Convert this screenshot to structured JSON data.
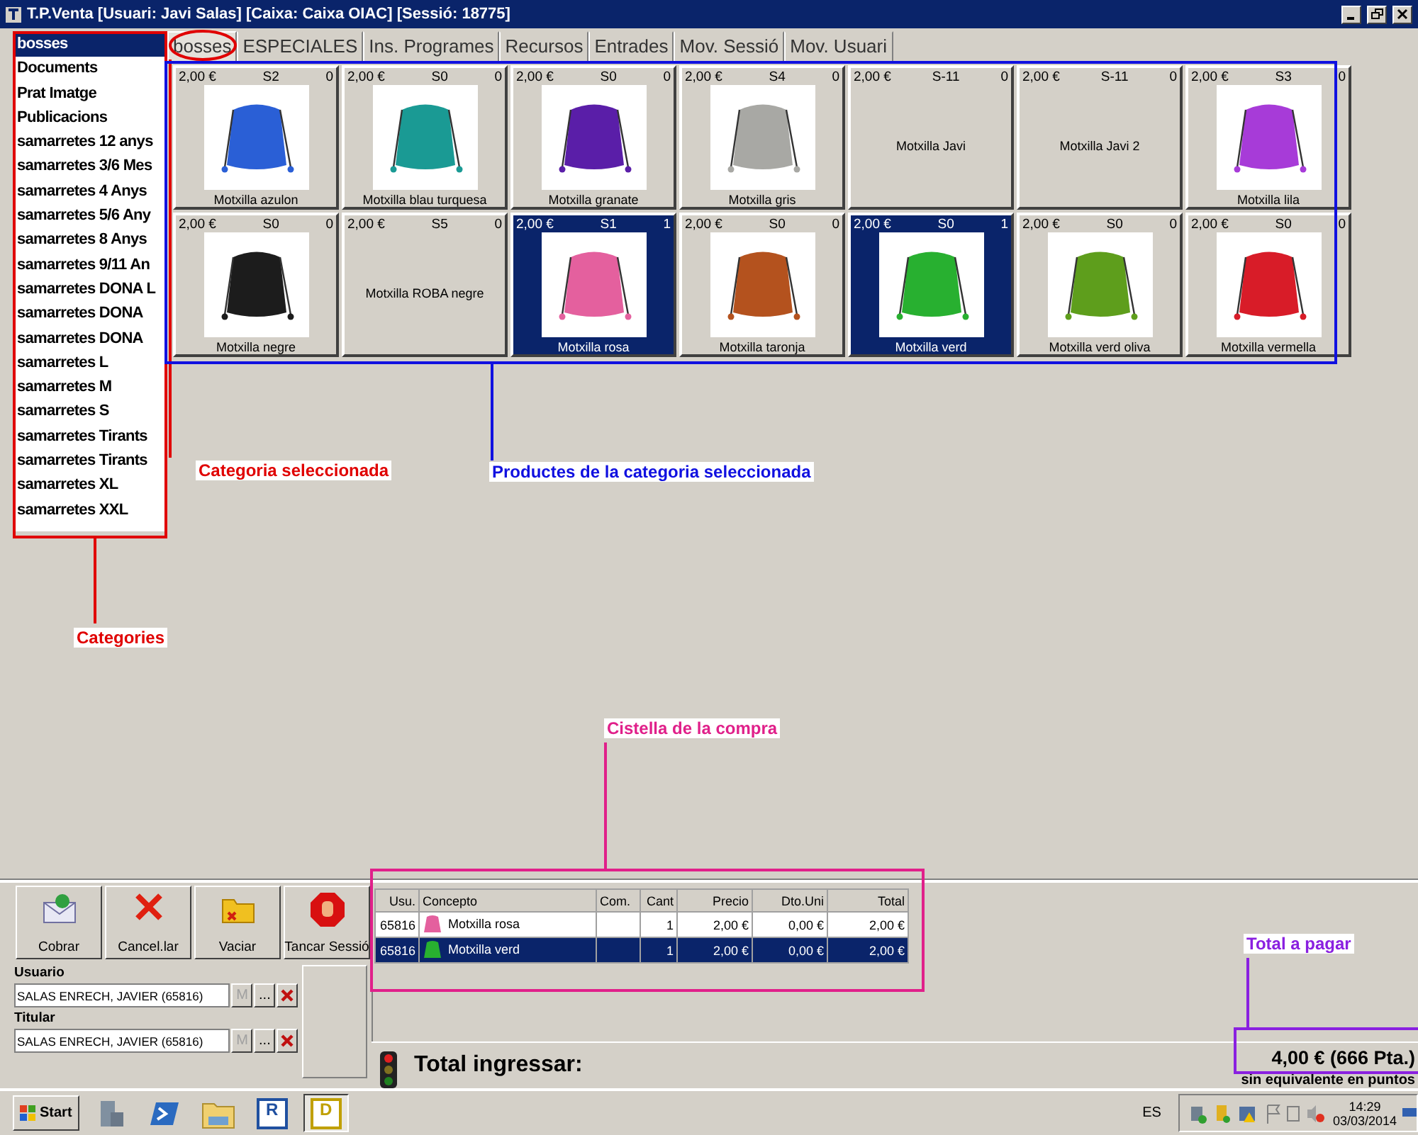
{
  "window": {
    "title": "T.P.Venta [Usuari: Javi Salas] [Caixa: Caixa OIAC] [Sessió: 18775]"
  },
  "categories": [
    {
      "label": "bosses",
      "selected": true
    },
    {
      "label": "Documents",
      "selected": false
    },
    {
      "label": "Prat Imatge",
      "selected": false
    },
    {
      "label": "Publicacions",
      "selected": false
    },
    {
      "label": "samarretes 12 anys",
      "selected": false
    },
    {
      "label": "samarretes 3/6 Mes",
      "selected": false
    },
    {
      "label": "samarretes 4 Anys",
      "selected": false
    },
    {
      "label": "samarretes 5/6 Any",
      "selected": false
    },
    {
      "label": "samarretes 8 Anys",
      "selected": false
    },
    {
      "label": "samarretes 9/11 An",
      "selected": false
    },
    {
      "label": "samarretes DONA L",
      "selected": false
    },
    {
      "label": "samarretes DONA",
      "selected": false
    },
    {
      "label": "samarretes DONA",
      "selected": false
    },
    {
      "label": "samarretes L",
      "selected": false
    },
    {
      "label": "samarretes M",
      "selected": false
    },
    {
      "label": "samarretes S",
      "selected": false
    },
    {
      "label": "samarretes Tirants",
      "selected": false
    },
    {
      "label": "samarretes Tirants",
      "selected": false
    },
    {
      "label": "samarretes XL",
      "selected": false
    },
    {
      "label": "samarretes XXL",
      "selected": false
    }
  ],
  "tabs": [
    {
      "label": "bosses",
      "selected": true
    },
    {
      "label": "ESPECIALES",
      "selected": false
    },
    {
      "label": "Ins. Programes",
      "selected": false
    },
    {
      "label": "Recursos",
      "selected": false
    },
    {
      "label": "Entrades",
      "selected": false
    },
    {
      "label": "Mov. Sessió",
      "selected": false
    },
    {
      "label": "Mov. Usuari",
      "selected": false
    }
  ],
  "products": [
    {
      "price": "2,00 €",
      "code": "S2",
      "count": "0",
      "name": "Motxilla azulon",
      "kind": "photo",
      "color": "#2a5fd6",
      "selected": false
    },
    {
      "price": "2,00 €",
      "code": "S0",
      "count": "0",
      "name": "Motxilla blau turquesa",
      "kind": "photo",
      "color": "#1a9a94",
      "selected": false
    },
    {
      "price": "2,00 €",
      "code": "S0",
      "count": "0",
      "name": "Motxilla granate",
      "kind": "photo",
      "color": "#5a1ea8",
      "selected": false
    },
    {
      "price": "2,00 €",
      "code": "S4",
      "count": "0",
      "name": "Motxilla gris",
      "kind": "photo",
      "color": "#a8a8a4",
      "selected": false
    },
    {
      "price": "2,00 €",
      "code": "S-11",
      "count": "0",
      "name": "Motxilla Javi",
      "kind": "text",
      "selected": false
    },
    {
      "price": "2,00 €",
      "code": "S-11",
      "count": "0",
      "name": "Motxilla Javi 2",
      "kind": "text",
      "selected": false
    },
    {
      "price": "2,00 €",
      "code": "S3",
      "count": "0",
      "name": "Motxilla lila",
      "kind": "photo",
      "color": "#a73bd8",
      "selected": false
    },
    {
      "price": "2,00 €",
      "code": "S0",
      "count": "0",
      "name": "Motxilla negre",
      "kind": "photo",
      "color": "#1c1c1c",
      "selected": false
    },
    {
      "price": "2,00 €",
      "code": "S5",
      "count": "0",
      "name": "Motxilla ROBA negre",
      "kind": "text",
      "selected": false
    },
    {
      "price": "2,00 €",
      "code": "S1",
      "count": "1",
      "name": "Motxilla rosa",
      "kind": "photo",
      "color": "#e4609e",
      "selected": true
    },
    {
      "price": "2,00 €",
      "code": "S0",
      "count": "0",
      "name": "Motxilla taronja",
      "kind": "photo",
      "color": "#b4521e",
      "selected": false
    },
    {
      "price": "2,00 €",
      "code": "S0",
      "count": "1",
      "name": "Motxilla verd",
      "kind": "photo",
      "color": "#28b030",
      "selected": true
    },
    {
      "price": "2,00 €",
      "code": "S0",
      "count": "0",
      "name": "Motxilla verd oliva",
      "kind": "photo",
      "color": "#5e9e1c",
      "selected": false
    },
    {
      "price": "2,00 €",
      "code": "S0",
      "count": "0",
      "name": "Motxilla vermella",
      "kind": "photo",
      "color": "#d81c28",
      "selected": false
    }
  ],
  "actions": [
    {
      "label": "Cobrar",
      "kind": "envelope"
    },
    {
      "label": "Cancel.lar",
      "kind": "cancel"
    },
    {
      "label": "Vaciar",
      "kind": "folder"
    },
    {
      "label": "Tancar Sessió",
      "kind": "stop"
    }
  ],
  "people": [
    {
      "label": "Usuario",
      "value": "SALAS ENRECH, JAVIER (65816)",
      "buttons": [
        {
          "label": "M",
          "disabled": true
        },
        {
          "label": "...",
          "disabled": false
        }
      ]
    },
    {
      "label": "Titular",
      "value": "SALAS ENRECH, JAVIER (65816)",
      "buttons": [
        {
          "label": "M",
          "disabled": true
        },
        {
          "label": "...",
          "disabled": false
        }
      ]
    }
  ],
  "cart": {
    "columns": [
      "Usu.",
      "Concepto",
      "Com.",
      "Cant",
      "Precio",
      "Dto.Uni",
      "Total"
    ],
    "rows": [
      {
        "user": "65816",
        "concept": "Motxilla rosa",
        "qty": "1",
        "price": "2,00 €",
        "discount": "0,00 €",
        "total": "2,00 €",
        "color": "#e4609e",
        "selected": false
      },
      {
        "user": "65816",
        "concept": "Motxilla verd",
        "qty": "1",
        "price": "2,00 €",
        "discount": "0,00 €",
        "total": "2,00 €",
        "color": "#28b030",
        "selected": true
      }
    ]
  },
  "total": {
    "label": "Total ingressar:",
    "amount": "4,00 € (666 Pta.)",
    "note": "sin equivalente en puntos"
  },
  "taskbar": {
    "start": "Start",
    "apps": [
      {
        "kind": "server"
      },
      {
        "kind": "powershell"
      },
      {
        "kind": "explorer"
      },
      {
        "kind": "letter",
        "label": "R",
        "selected": false
      },
      {
        "kind": "letter",
        "label": "D",
        "selected": true
      }
    ],
    "language": "ES",
    "time": "14:29",
    "date": "03/03/2014"
  },
  "annotations": [
    {
      "label": "Categories",
      "color": "#e00000"
    },
    {
      "label": "Categoria seleccionada",
      "color": "#e00000"
    },
    {
      "label": "Productes de la categoria seleccionada",
      "color": "#1010e0"
    },
    {
      "label": "Cistella de la compra",
      "color": "#e0208a"
    },
    {
      "label": "Total a pagar",
      "color": "#8a20e0"
    }
  ]
}
